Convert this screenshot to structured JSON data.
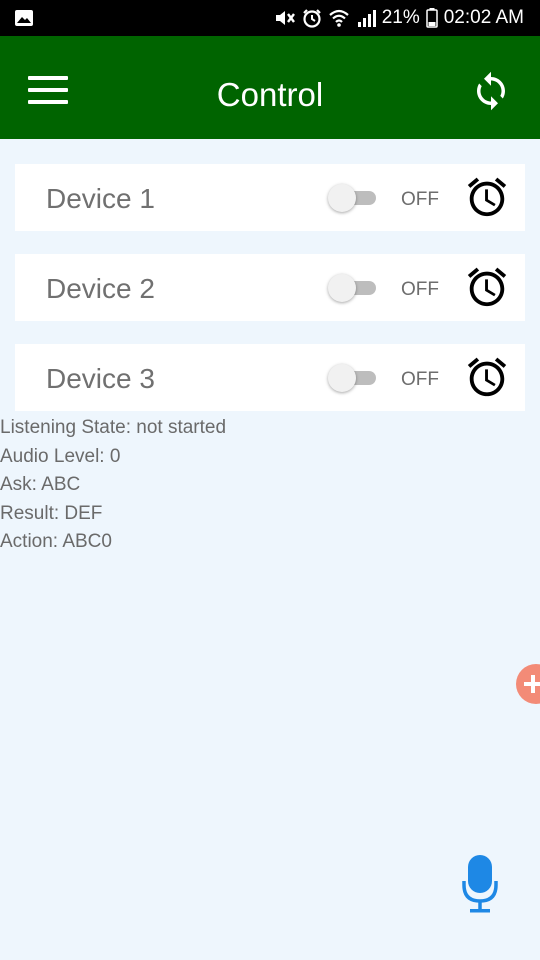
{
  "status_bar": {
    "battery": "21%",
    "time": "02:02 AM"
  },
  "app_bar": {
    "title": "Control"
  },
  "devices": [
    {
      "name": "Device 1",
      "state": "OFF"
    },
    {
      "name": "Device 2",
      "state": "OFF"
    },
    {
      "name": "Device 3",
      "state": "OFF"
    }
  ],
  "info": {
    "listening_state": "Listening State: not started",
    "audio_level": "Audio Level: 0",
    "ask": "Ask: ABC",
    "result": "Result: DEF",
    "action": "Action: ABC0"
  },
  "icons": {
    "gallery": "image-icon",
    "mute": "mute-icon",
    "alarm_status": "alarm-clock-icon",
    "wifi": "wifi-icon",
    "signal": "signal-icon",
    "battery": "battery-icon",
    "menu": "hamburger-menu-icon",
    "refresh": "sync-icon",
    "timer": "alarm-clock-icon",
    "mic": "microphone-icon"
  },
  "colors": {
    "app_bar": "#006400",
    "background": "#eef6fd",
    "mic": "#1e88e5",
    "fab": "#f38b77"
  }
}
